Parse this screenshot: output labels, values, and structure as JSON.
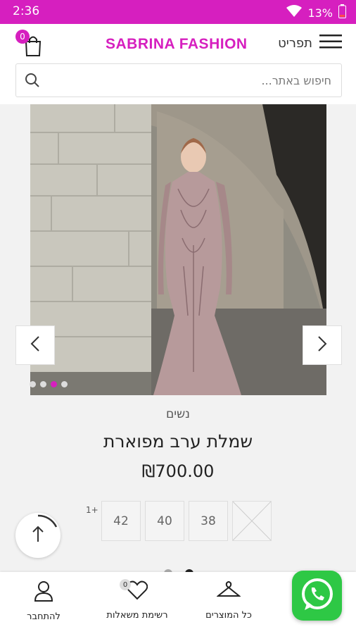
{
  "status_bar": {
    "time": "2:36",
    "battery": "13%"
  },
  "header": {
    "brand": "SABRINA FASHION",
    "menu_label": "תפריט",
    "cart_count": "0",
    "search_placeholder": "חיפוש באתר..."
  },
  "gallery": {
    "slide_count": 4,
    "active_index": 2
  },
  "product": {
    "category": "נשים",
    "title": "שמלת ערב מפוארת",
    "price": "₪700.00",
    "sizes": [
      "42",
      "40",
      "38"
    ],
    "more_sizes": "1+"
  },
  "bottom_nav": {
    "products": "כל המוצרים",
    "wishlist": "רשימת משאלות",
    "wishlist_count": "0",
    "login": "להתחבר"
  },
  "colors": {
    "brand": "#d61fbf",
    "whatsapp": "#2ec845"
  }
}
